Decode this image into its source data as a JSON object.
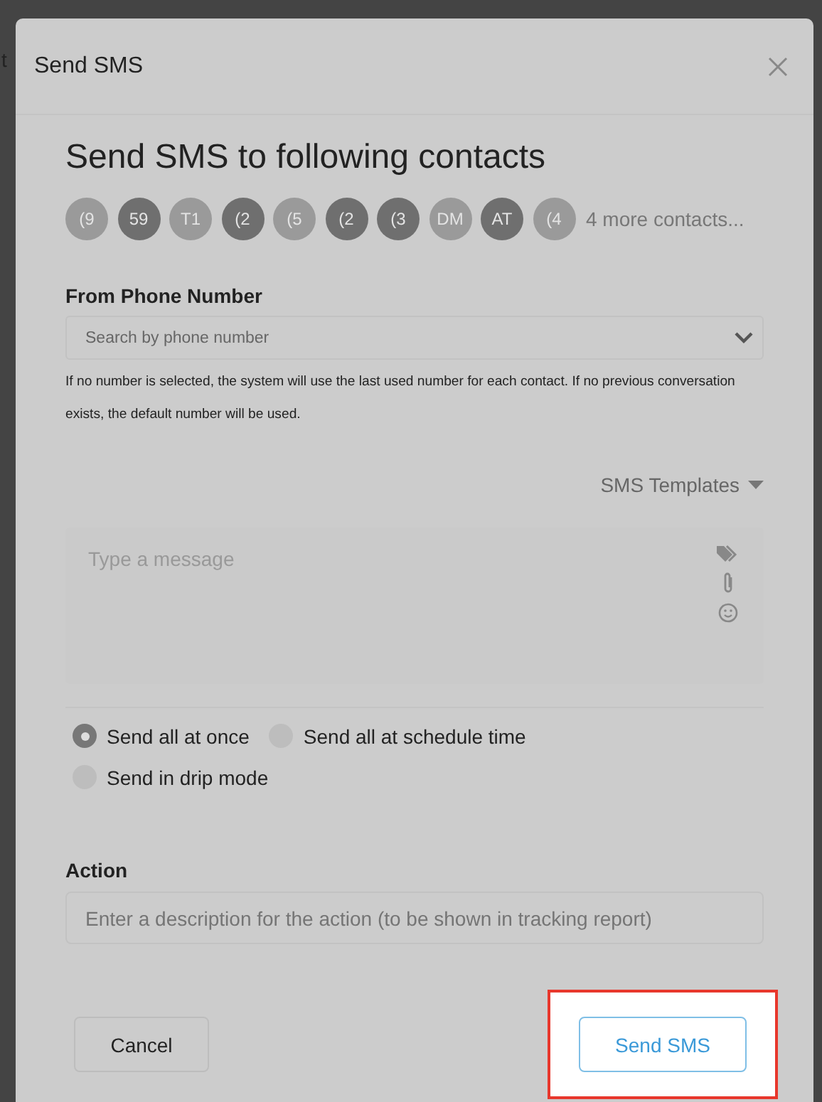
{
  "background_text": "t",
  "dialog": {
    "title": "Send SMS",
    "heading": "Send SMS to following contacts",
    "contacts": [
      {
        "initials": "(9",
        "color": "#9a9a9a"
      },
      {
        "initials": "59",
        "color": "#6f6f6f"
      },
      {
        "initials": "T1",
        "color": "#9a9a9a"
      },
      {
        "initials": "(2",
        "color": "#6f6f6f"
      },
      {
        "initials": "(5",
        "color": "#9a9a9a"
      },
      {
        "initials": "(2",
        "color": "#6f6f6f"
      },
      {
        "initials": "(3",
        "color": "#6f6f6f"
      },
      {
        "initials": "DM",
        "color": "#9a9a9a"
      },
      {
        "initials": "AT",
        "color": "#6f6f6f"
      },
      {
        "initials": "(4",
        "color": "#9a9a9a"
      }
    ],
    "more_contacts": "4 more contacts...",
    "from_label": "From Phone Number",
    "from_placeholder": "Search by phone number",
    "help_text": "If no number is selected, the system will use the last used number for each contact. If no previous conversation exists, the default number will be used.",
    "templates": "SMS Templates",
    "message_placeholder": "Type a message",
    "send_modes": [
      {
        "label": "Send all at once",
        "selected": true
      },
      {
        "label": "Send all at schedule time",
        "selected": false
      },
      {
        "label": "Send in drip mode",
        "selected": false
      }
    ],
    "action_label": "Action",
    "action_placeholder": "Enter a description for the action (to be shown in tracking report)",
    "buttons": [
      {
        "label": "Cancel",
        "kind": "secondary",
        "highlighted": false
      },
      {
        "label": "Send SMS",
        "kind": "primary",
        "highlighted": true
      }
    ]
  }
}
